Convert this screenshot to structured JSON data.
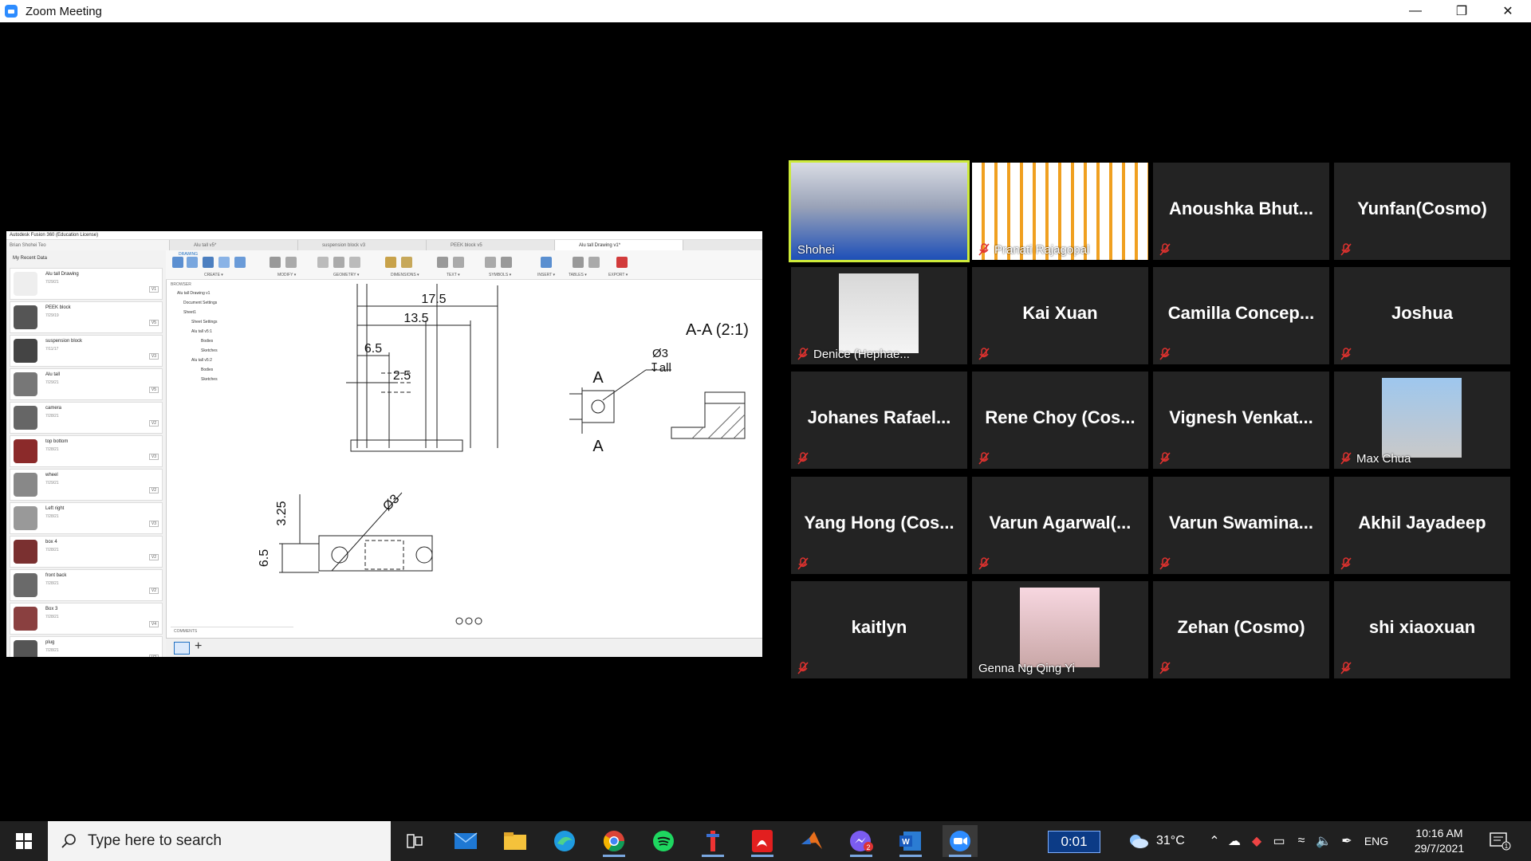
{
  "window": {
    "title": "Zoom Meeting",
    "controls": [
      "minimize-icon",
      "restore-icon",
      "close-icon"
    ]
  },
  "shared_screen": {
    "app_title": "Autodesk Fusion 360 (Education License)",
    "project_selector": "Brian Shohei Teo",
    "tabs": [
      "Alu tall v5*",
      "suspension block v3",
      "PEEK block v5",
      "Alu tall Drawing v1*"
    ],
    "workspace_tag": "DRAWING",
    "toolbar_groups": [
      "CREATE ▾",
      "MODIFY ▾",
      "GEOMETRY ▾",
      "DIMENSIONS ▾",
      "TEXT ▾",
      "SYMBOLS ▾",
      "INSERT ▾",
      "TABLES ▾",
      "EXPORT ▾"
    ],
    "data_panel": {
      "header": "My Recent Data",
      "items": [
        {
          "name": "Alu tall Drawing",
          "date": "7/29/21",
          "version": "V1"
        },
        {
          "name": "PEEK block",
          "date": "7/29/19",
          "version": "V5"
        },
        {
          "name": "suspension block",
          "date": "7/11/17",
          "version": "V3"
        },
        {
          "name": "Alu tall",
          "date": "7/29/21",
          "version": "V5"
        },
        {
          "name": "camera",
          "date": "7/28/21",
          "version": "V2"
        },
        {
          "name": "top bottom",
          "date": "7/28/21",
          "version": "V3"
        },
        {
          "name": "wheel",
          "date": "7/29/21",
          "version": "V2"
        },
        {
          "name": "Left right",
          "date": "7/28/21",
          "version": "V3"
        },
        {
          "name": "box 4",
          "date": "7/28/21",
          "version": "V2"
        },
        {
          "name": "front back",
          "date": "7/28/21",
          "version": "V2"
        },
        {
          "name": "Box 3",
          "date": "7/28/21",
          "version": "V4"
        },
        {
          "name": "plug",
          "date": "7/28/21",
          "version": "V2"
        }
      ]
    },
    "browser": {
      "header": "BROWSER",
      "rows": [
        "Alu tall Drawing v1",
        "Document Settings",
        "Sheet1",
        "Sheet Settings",
        "Alu tall v5:1",
        "Bodies",
        "Sketches",
        "Alu tall v5:2",
        "Bodies",
        "Sketches"
      ]
    },
    "comments_label": "COMMENTS",
    "drawing": {
      "dim_17_5": "17.5",
      "dim_13_5": "13.5",
      "dim_6_5_top": "6.5",
      "dim_2_5": "2.5",
      "section_title": "A-A (2:1)",
      "section_marker_top": "A",
      "section_marker_bottom": "A",
      "hole_callout": "Ø3",
      "hole_depth": "↧all",
      "dim_3_25": "3.25",
      "dim_6_5_side": "6.5",
      "dim_phi3": "Ø3"
    }
  },
  "participants": [
    {
      "name": "Shohei",
      "video": true,
      "active_speaker": true,
      "muted": false
    },
    {
      "name": "Pranati Rajagopal",
      "video": true,
      "muted": true
    },
    {
      "name": "Anoushka Bhut...",
      "video": false,
      "muted": true
    },
    {
      "name": "Yunfan(Cosmo)",
      "video": false,
      "muted": true
    },
    {
      "name": "Denice (Hephae...",
      "video": true,
      "muted": true
    },
    {
      "name": "Kai Xuan",
      "video": false,
      "muted": true
    },
    {
      "name": "Camilla Concep...",
      "video": false,
      "muted": true
    },
    {
      "name": "Joshua",
      "video": false,
      "muted": true
    },
    {
      "name": "Johanes Rafael...",
      "video": false,
      "muted": true
    },
    {
      "name": "Rene Choy (Cos...",
      "video": false,
      "muted": true
    },
    {
      "name": "Vignesh Venkat...",
      "video": false,
      "muted": true
    },
    {
      "name": "Max Chua",
      "video": true,
      "muted": true
    },
    {
      "name": "Yang Hong (Cos...",
      "video": false,
      "muted": true
    },
    {
      "name": "Varun Agarwal(...",
      "video": false,
      "muted": true
    },
    {
      "name": "Varun Swamina...",
      "video": false,
      "muted": true
    },
    {
      "name": "Akhil Jayadeep",
      "video": false,
      "muted": true
    },
    {
      "name": "kaitlyn",
      "video": false,
      "muted": true
    },
    {
      "name": "Genna Ng Qing Yi",
      "video": true,
      "muted": false
    },
    {
      "name": "Zehan (Cosmo)",
      "video": false,
      "muted": true
    },
    {
      "name": "shi xiaoxuan",
      "video": false,
      "muted": true
    }
  ],
  "taskbar": {
    "search_placeholder": "Type here to search",
    "apps": [
      "task-view-icon",
      "mail-icon",
      "file-explorer-icon",
      "edge-icon",
      "chrome-icon",
      "spotify-icon",
      "tool-icon",
      "acrobat-icon",
      "matlab-icon",
      "messenger-icon",
      "word-icon",
      "zoom-icon"
    ],
    "messenger_badge": "2",
    "timer": "0:01",
    "weather": "31°C",
    "language": "ENG",
    "time": "10:16 AM",
    "date": "29/7/2021",
    "notifications": "1"
  }
}
